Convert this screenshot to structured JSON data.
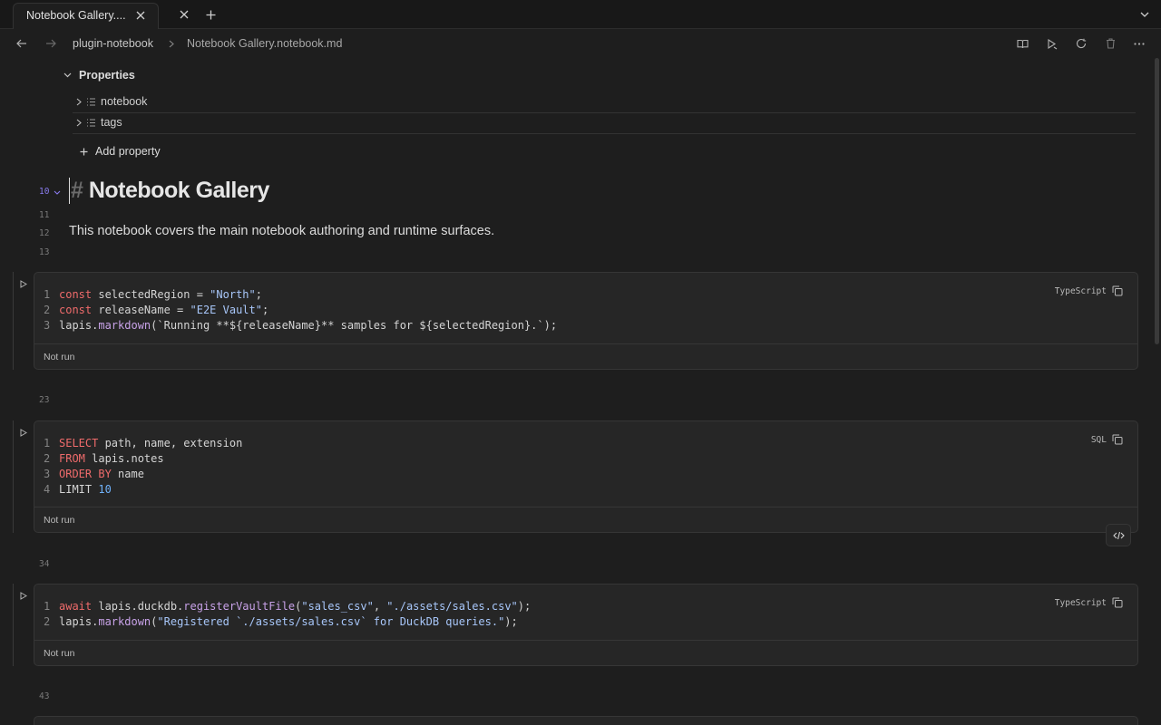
{
  "tab": {
    "title": "Notebook Gallery...."
  },
  "breadcrumb": {
    "folder": "plugin-notebook",
    "file": "Notebook Gallery.notebook.md"
  },
  "properties": {
    "heading": "Properties",
    "items": [
      {
        "label": "notebook"
      },
      {
        "label": "tags"
      }
    ],
    "add_label": "Add property"
  },
  "document": {
    "heading_marker": "#",
    "heading": "Notebook Gallery",
    "heading_line": "10",
    "blank_line": "11",
    "paragraph_line": "12",
    "paragraph": "This notebook covers the main notebook authoring and runtime surfaces.",
    "after_line": "13"
  },
  "cells": [
    {
      "language": "TypeScript",
      "status": "Not run"
    },
    {
      "language": "SQL",
      "status": "Not run",
      "line_before": "23"
    },
    {
      "language": "TypeScript",
      "status": "Not run",
      "line_before": "34"
    }
  ],
  "trailing_line": "43",
  "code_tokens": {
    "c1l1": [
      "const",
      " selectedRegion = ",
      "\"North\"",
      ";"
    ],
    "c1l2": [
      "const",
      " releaseName = ",
      "\"E2E Vault\"",
      ";"
    ],
    "c1l3": [
      "lapis.",
      "markdown",
      "(`Running **${releaseName}** samples for ${selectedRegion}.`);"
    ],
    "c2l1": [
      "SELECT",
      " path, name, extension"
    ],
    "c2l2": [
      "FROM",
      " lapis.notes"
    ],
    "c2l3": [
      "ORDER",
      " ",
      "BY",
      " name"
    ],
    "c2l4": [
      "LIMIT ",
      "10"
    ],
    "c3l1": [
      "await",
      " lapis.duckdb.",
      "registerVaultFile",
      "(",
      "\"sales_csv\"",
      ", ",
      "\"./assets/sales.csv\"",
      ");"
    ],
    "c3l2": [
      "lapis.",
      "markdown",
      "(",
      "\"Registered `./assets/sales.csv` for DuckDB queries.\"",
      ");"
    ]
  },
  "colors": {
    "background": "#1e1e1e",
    "keyword": "#ef6b6b",
    "string": "#a8c7fa",
    "number": "#6fb1fa",
    "accent": "#8a7cf0"
  }
}
